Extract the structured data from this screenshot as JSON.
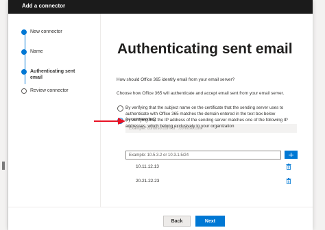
{
  "dialog": {
    "title": "Add a connector"
  },
  "steps": [
    {
      "label": "New connector",
      "state": "done"
    },
    {
      "label": "Name",
      "state": "done"
    },
    {
      "label": "Authenticating sent email",
      "state": "current"
    },
    {
      "label": "Review connector",
      "state": "todo"
    }
  ],
  "main": {
    "heading": "Authenticating sent email",
    "question": "How should Office 365 identify email from your email server?",
    "instruction": "Choose how Office 365 will authenticate and accept email sent from your email server.",
    "option_cert": {
      "line1": "By verifying that the subject name on the certificate that the sending server uses to",
      "line2": "authenticate with Office 365 matches the domain entered in the text box below",
      "line3": "(recommended)",
      "placeholder": "Example: contoso.com or *.contoso.com",
      "selected": false
    },
    "option_ip": {
      "line1": "By verifying that the IP address of the sending server matches one of the following IP",
      "line2": "addresses, which belong exclusively to your organization",
      "placeholder": "Example: 10.5.3.2 or 10.3.1.5/24",
      "selected": true
    },
    "ip_list": [
      "10.11.12.13",
      "20.21.22.23"
    ]
  },
  "footer": {
    "back_label": "Back",
    "next_label": "Next"
  },
  "colors": {
    "accent": "#0078d4",
    "annotation_arrow": "#e81123",
    "titlebar": "#1b1b1b"
  },
  "icons": {
    "add": "plus-icon",
    "delete": "trash-icon"
  }
}
